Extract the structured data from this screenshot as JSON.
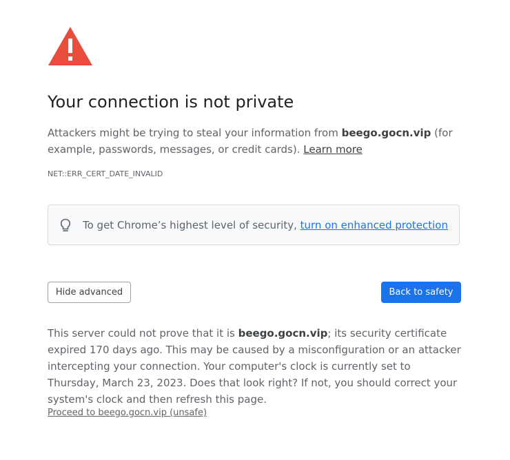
{
  "colors": {
    "warning_red": "#E74C3C",
    "primary_blue": "#1A73E8",
    "text_dark": "#202124",
    "text_body": "#5F6368",
    "tip_background": "#F8F9FA"
  },
  "icons": {
    "warning": "warning-triangle-icon",
    "tip": "lightbulb-icon"
  },
  "headline": "Your connection is not private",
  "explanation": {
    "before": "Attackers might be trying to steal your information from ",
    "domain": "beego.gocn.vip",
    "after": " (for example, passwords, messages, or credit cards). ",
    "learn_more": "Learn more"
  },
  "error_code": "NET::ERR_CERT_DATE_INVALID",
  "tip": {
    "text": "To get Chrome’s highest level of security, ",
    "link": "turn on enhanced protection"
  },
  "buttons": {
    "hide_advanced": "Hide advanced",
    "back_to_safety": "Back to safety"
  },
  "details": {
    "before": "This server could not prove that it is ",
    "domain": "beego.gocn.vip",
    "after": "; its security certificate expired 170 days ago. This may be caused by a misconfiguration or an attacker intercepting your connection. Your computer's clock is currently set to Thursday, March 23, 2023. Does that look right? If not, you should correct your system's clock and then refresh this page."
  },
  "proceed_link": "Proceed to beego.gocn.vip (unsafe)"
}
